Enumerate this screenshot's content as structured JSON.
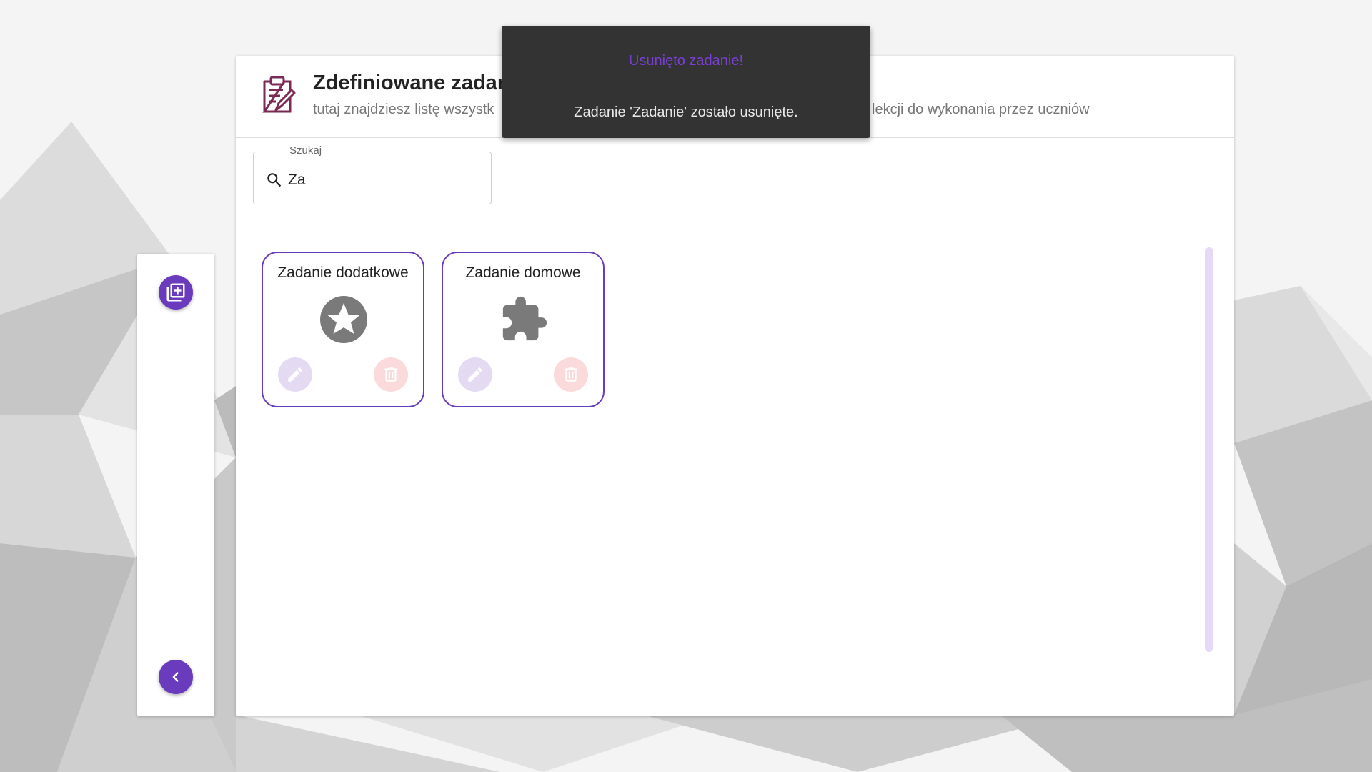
{
  "colors": {
    "accent": "#6a3bbd",
    "edit_button_bg": "#e4dbf3",
    "delete_button_bg": "#fadada",
    "toast_bg": "#333333",
    "toast_title": "#7a3fd6"
  },
  "header": {
    "title": "Zdefiniowane zadan",
    "subtitle_left": "tutaj znajdziesz listę wszystk",
    "subtitle_right": "lekcji do wykonania przez uczniów",
    "icon": "clipboard-edit-icon"
  },
  "search": {
    "label": "Szukaj",
    "value": "Za",
    "icon": "search-icon"
  },
  "sidebar": {
    "add_icon": "library-add-icon",
    "back_icon": "chevron-left-icon"
  },
  "cards": [
    {
      "title": "Zadanie dodatkowe",
      "icon": "star-circle-icon"
    },
    {
      "title": "Zadanie domowe",
      "icon": "puzzle-icon"
    }
  ],
  "toast": {
    "title": "Usunięto zadanie!",
    "message": "Zadanie 'Zadanie' zostało usunięte."
  }
}
